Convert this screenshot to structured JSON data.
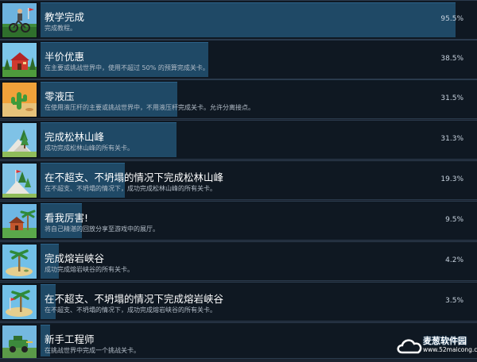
{
  "achievements": [
    {
      "title": "教学完成",
      "description": "完成教程。",
      "percent_label": "95.5%",
      "percent": 95.5,
      "icon": "biker-tutorial-icon"
    },
    {
      "title": "半价优惠",
      "description": "在主要或挑战世界中，使用不超过 50% 的预算完成关卡。",
      "percent_label": "38.5%",
      "percent": 38.5,
      "icon": "red-house-icon"
    },
    {
      "title": "零液压",
      "description": "在使用液压杆的主要或挑战世界中，不用液压杆完成关卡。允许分离接点。",
      "percent_label": "31.5%",
      "percent": 31.5,
      "icon": "desert-cactus-icon"
    },
    {
      "title": "完成松林山峰",
      "description": "成功完成松林山峰的所有关卡。",
      "percent_label": "31.3%",
      "percent": 31.3,
      "icon": "pine-mountain-icon"
    },
    {
      "title": "在不超支、不坍塌的情况下完成松林山峰",
      "description": "在不超支、不坍塌的情况下，成功完成松林山峰的所有关卡。",
      "percent_label": "19.3%",
      "percent": 19.3,
      "icon": "pine-mountain-flag-icon"
    },
    {
      "title": "看我厉害!",
      "description": "将自己精湛的回放分享至游戏中的展厅。",
      "percent_label": "9.5%",
      "percent": 9.5,
      "icon": "palm-house-icon"
    },
    {
      "title": "完成熔岩峡谷",
      "description": "成功完成熔岩峡谷的所有关卡。",
      "percent_label": "4.2%",
      "percent": 4.2,
      "icon": "palm-island-icon"
    },
    {
      "title": "在不超支、不坍塌的情况下完成熔岩峡谷",
      "description": "在不超支、不坍塌的情况下，成功完成熔岩峡谷的所有关卡。",
      "percent_label": "3.5%",
      "percent": 3.5,
      "icon": "palm-island-flag-icon"
    },
    {
      "title": "新手工程师",
      "description": "在挑战世界中完成一个挑战关卡。",
      "percent_label": "2.2%",
      "percent": 2.2,
      "icon": "green-vehicle-icon"
    }
  ],
  "watermark": {
    "name": "麦葱软件园",
    "url": "www.52maicong.com"
  },
  "colors": {
    "background": "#0f1822",
    "bar": "#1f4966",
    "border": "#2a3a4c"
  }
}
